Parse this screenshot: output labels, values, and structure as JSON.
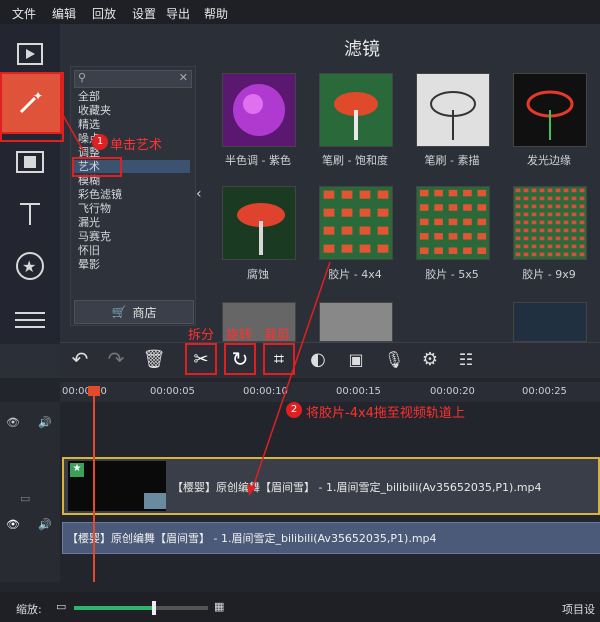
{
  "menu": [
    "文件",
    "编辑",
    "回放",
    "设置",
    "导出",
    "帮助"
  ],
  "filter_panel": {
    "title": "滤镜",
    "categories": [
      "全部",
      "收藏夹",
      "精选",
      "噪点",
      "调整",
      "艺术",
      "模糊",
      "彩色滤镜",
      "飞行物",
      "漏光",
      "马赛克",
      "怀旧",
      "晕影"
    ],
    "selected_category": "艺术",
    "shop_label": "商店",
    "filters": [
      {
        "label": "半色调 - 紫色",
        "color": "#b03ad0"
      },
      {
        "label": "笔刷 - 饱和度",
        "color": "#e04a2a"
      },
      {
        "label": "笔刷 - 素描",
        "color": "#d0d0d0"
      },
      {
        "label": "发光边缘",
        "color": "#e23b2b"
      },
      {
        "label": "腐蚀",
        "color": "#e0432d"
      },
      {
        "label": "胶片 - 4x4",
        "color": "#e25533"
      },
      {
        "label": "胶片 - 5x5",
        "color": "#e25533"
      },
      {
        "label": "胶片 - 9x9",
        "color": "#d8503a"
      }
    ]
  },
  "annotations": {
    "step1_num": "1",
    "step1_text": "单击艺术",
    "tool_labels": [
      "拆分",
      "旋转",
      "裁剪"
    ],
    "step2_num": "2",
    "step2_text": "将胶片-4x4拖至视频轨道上"
  },
  "timeline": {
    "ruler": [
      "00:00:00",
      "00:00:05",
      "00:00:10",
      "00:00:15",
      "00:00:20",
      "00:00:25"
    ],
    "video_clip": "【樱婴】原创编舞【眉间雪】 - 1.眉间雪定_bilibili(Av35652035,P1).mp4",
    "audio_clip": "【樱婴】原创编舞【眉间雪】 - 1.眉间雪定_bilibili(Av35652035,P1).mp4"
  },
  "bottom": {
    "zoom_label": "缩放:",
    "zoom_value": 0.6,
    "project_label": "项目设"
  },
  "colors": {
    "accent": "#e0533b",
    "highlight": "#e02020",
    "clip_border": "#d9b340"
  }
}
